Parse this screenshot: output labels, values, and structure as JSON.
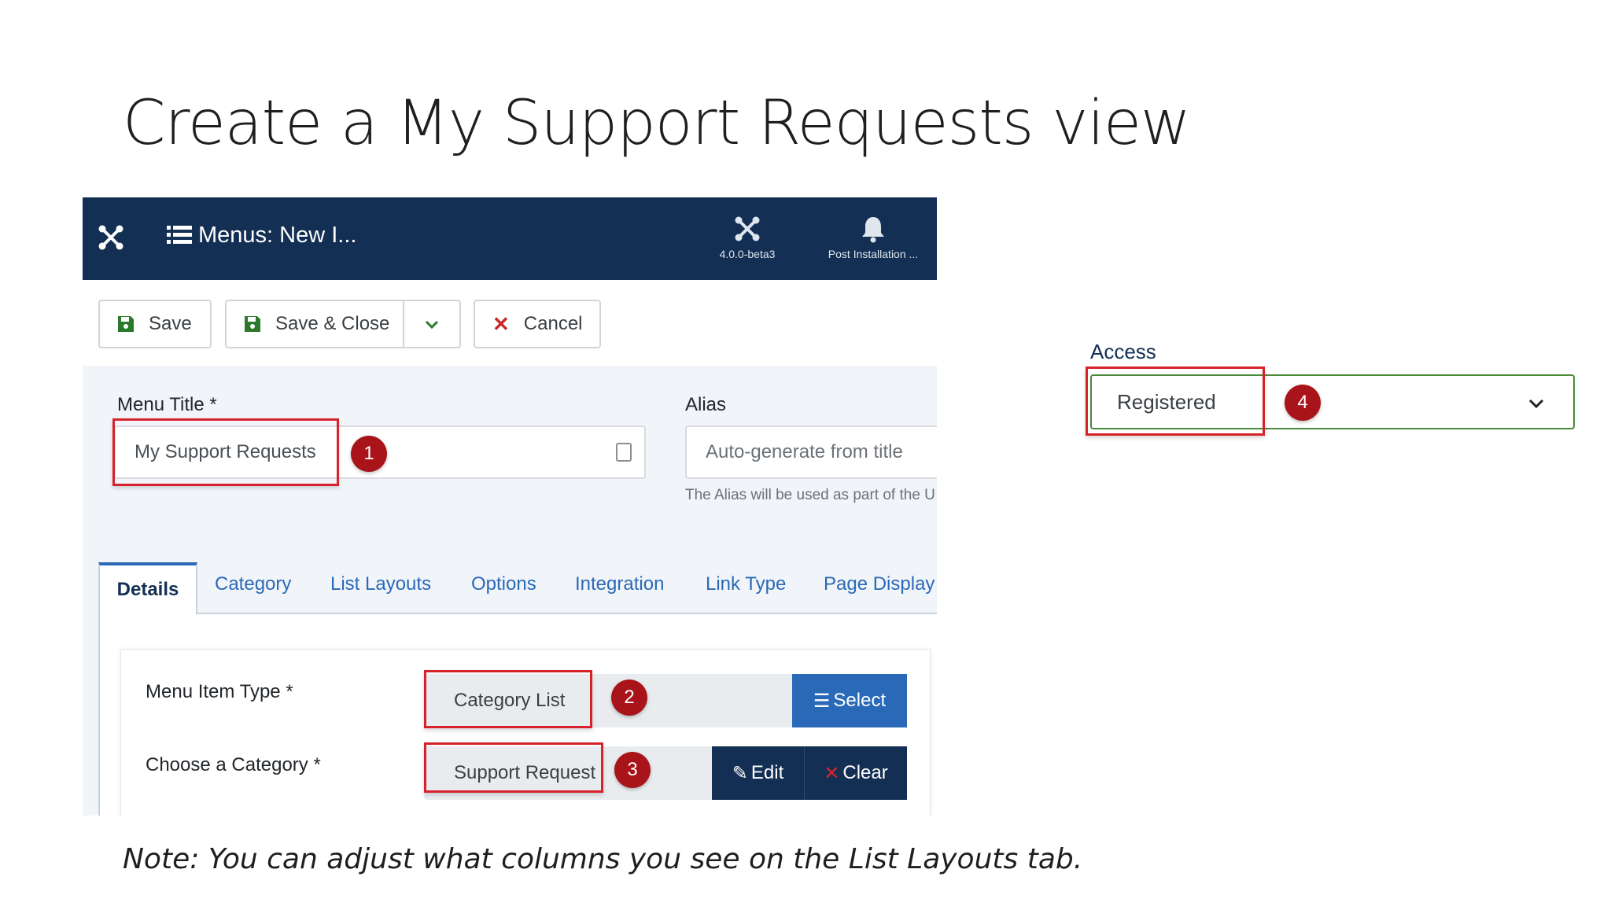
{
  "slide": {
    "title": "Create a My Support Requests view",
    "note": "Note: You can adjust what columns you see on the List Layouts tab."
  },
  "header": {
    "title": "Menus: New I...",
    "version_label": "4.0.0-beta3",
    "post_install_label": "Post Installation ..."
  },
  "toolbar": {
    "save_label": "Save",
    "save_close_label": "Save & Close",
    "cancel_label": "Cancel"
  },
  "form": {
    "menu_title_label": "Menu Title *",
    "menu_title_value": "My Support Requests",
    "alias_label": "Alias",
    "alias_placeholder": "Auto-generate from title",
    "alias_help": "The Alias will be used as part of the U"
  },
  "tabs": [
    "Details",
    "Category",
    "List Layouts",
    "Options",
    "Integration",
    "Link Type",
    "Page Display"
  ],
  "details": {
    "menu_item_type_label": "Menu Item Type *",
    "menu_item_type_value": "Category List",
    "select_label": "Select",
    "choose_category_label": "Choose a Category *",
    "choose_category_value": "Support Request",
    "edit_label": "Edit",
    "clear_label": "Clear"
  },
  "access": {
    "label": "Access",
    "value": "Registered"
  },
  "callouts": [
    "1",
    "2",
    "3",
    "4"
  ],
  "colors": {
    "header_bg": "#132f53",
    "accent_blue": "#2a69b8",
    "callout_red": "#d6232b",
    "badge_red": "#a8141a",
    "access_border": "#4a8a3a"
  },
  "icons": {
    "logo": "joomla-icon",
    "menu": "list-icon",
    "version": "joomla-icon",
    "post_install": "bell-icon",
    "save": "floppy-icon",
    "cancel": "x-icon",
    "dropdown": "chevron-down-icon"
  }
}
